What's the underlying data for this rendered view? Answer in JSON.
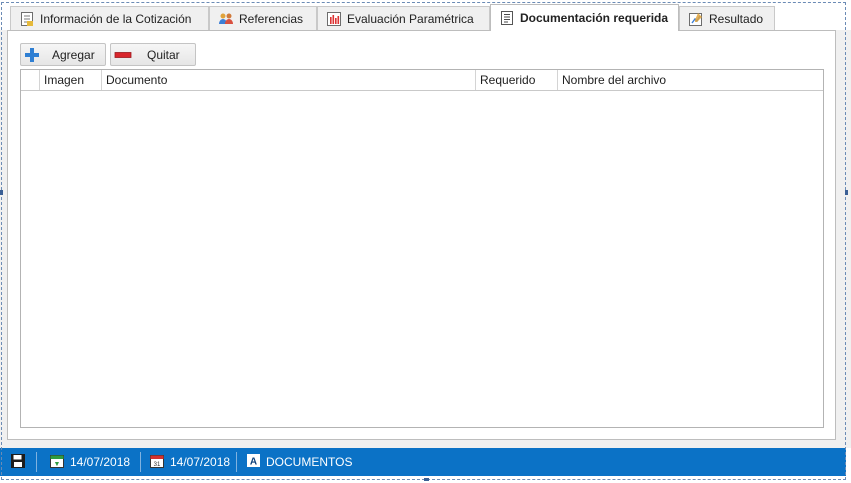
{
  "tabs": [
    {
      "label": "Información de la Cotización",
      "icon": "document-list-icon",
      "active": false
    },
    {
      "label": "Referencias",
      "icon": "people-icon",
      "active": false
    },
    {
      "label": "Evaluación Paramétrica",
      "icon": "bar-chart-icon",
      "active": false
    },
    {
      "label": "Documentación requerida",
      "icon": "document-icon",
      "active": true
    },
    {
      "label": "Resultado",
      "icon": "edit-chart-icon",
      "active": false
    }
  ],
  "toolbar": {
    "add_label": "Agregar",
    "remove_label": "Quitar"
  },
  "grid": {
    "columns": [
      "",
      "Imagen",
      "Documento",
      "Requerido",
      "Nombre del archivo"
    ],
    "rows": []
  },
  "statusbar": {
    "date_start": "14/07/2018",
    "date_end": "14/07/2018",
    "section": "DOCUMENTOS"
  },
  "colors": {
    "statusbar_bg": "#0b72c6",
    "add_icon": "#2f7fd3",
    "remove_icon": "#d9262c"
  }
}
